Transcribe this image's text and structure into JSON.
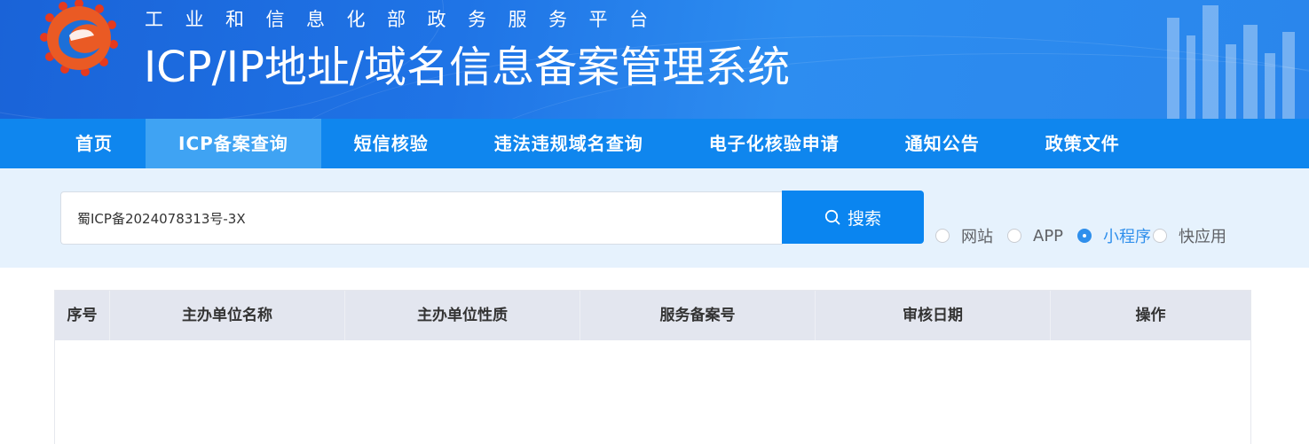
{
  "header": {
    "subtitle": "工业和信息化部政务服务平台",
    "title": "ICP/IP地址/域名信息备案管理系统",
    "logo_icon": "miit-gear-logo-icon"
  },
  "nav": {
    "items": [
      {
        "label": "首页",
        "active": false
      },
      {
        "label": "ICP备案查询",
        "active": true
      },
      {
        "label": "短信核验",
        "active": false
      },
      {
        "label": "违法违规域名查询",
        "active": false
      },
      {
        "label": "电子化核验申请",
        "active": false
      },
      {
        "label": "通知公告",
        "active": false
      },
      {
        "label": "政策文件",
        "active": false
      }
    ]
  },
  "search": {
    "value": "蜀ICP备2024078313号-3X",
    "button_label": "搜索",
    "button_icon": "search-icon",
    "types": [
      {
        "label": "网站",
        "checked": false
      },
      {
        "label": "APP",
        "checked": false
      },
      {
        "label": "小程序",
        "checked": true
      },
      {
        "label": "快应用",
        "checked": false
      }
    ]
  },
  "table": {
    "columns": [
      "序号",
      "主办单位名称",
      "主办单位性质",
      "服务备案号",
      "审核日期",
      "操作"
    ],
    "rows": []
  },
  "colors": {
    "nav_bg": "#0f86ee",
    "nav_active_bg": "#3fa3f3",
    "search_button": "#0a85f0",
    "radio_checked": "#2f8fec",
    "search_band_bg": "#e6f2fd",
    "table_header_bg": "#e3e6ef"
  }
}
